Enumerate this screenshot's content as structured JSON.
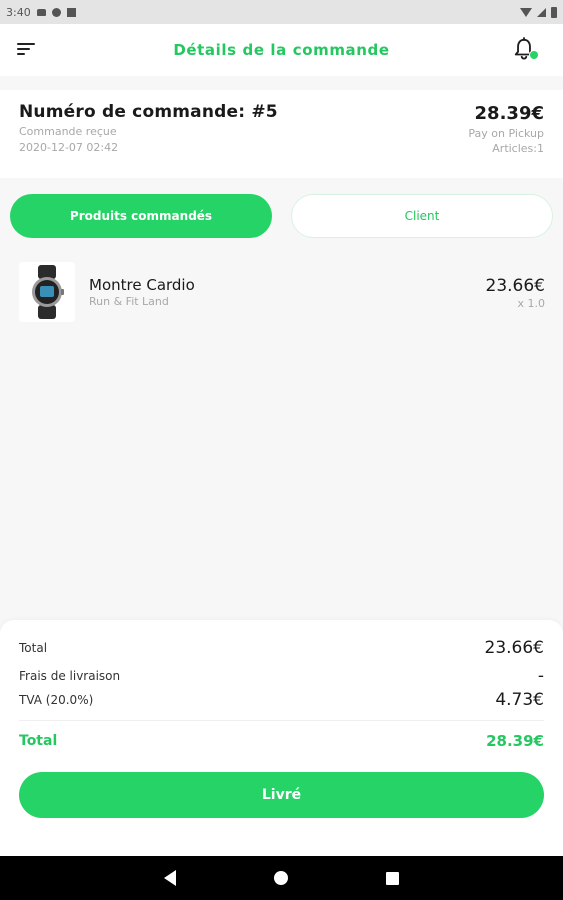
{
  "status_bar": {
    "time": "3:40",
    "left_icons": [
      "notification-icon",
      "notification-icon",
      "sim-card-icon"
    ],
    "right_icons": [
      "wifi-icon",
      "signal-icon",
      "battery-icon"
    ]
  },
  "header": {
    "title": "Détails de la commande",
    "menu_icon": "menu-icon",
    "notification_icon": "bell-icon"
  },
  "order": {
    "number": "Numéro de commande: #5",
    "status": "Commande reçue",
    "date": "2020-12-07 02:42",
    "total": "28.39€",
    "payment_method": "Pay on Pickup",
    "articles": "Articles:1"
  },
  "tabs": {
    "products": "Produits commandés",
    "client": "Client",
    "active": "products"
  },
  "products": [
    {
      "name": "Montre Cardio",
      "vendor": "Run & Fit Land",
      "price": "23.66€",
      "quantity": "x 1.0",
      "thumbnail_icon": "smartwatch-icon"
    }
  ],
  "totals": {
    "subtotal_label": "Total",
    "subtotal_value": "23.66€",
    "delivery_label": "Frais de livraison",
    "delivery_value": "-",
    "tax_label": "TVA (20.0%)",
    "tax_value": "4.73€",
    "grand_total_label": "Total",
    "grand_total_value": "28.39€"
  },
  "action": {
    "deliver_label": "Livré"
  },
  "colors": {
    "accent": "#25d366",
    "accent_text": "#25c760",
    "muted_text": "#a8a8a8",
    "background": "#f7f7f7"
  },
  "nav_bar": {
    "icons": [
      "back-icon",
      "home-icon",
      "recent-apps-icon"
    ]
  }
}
